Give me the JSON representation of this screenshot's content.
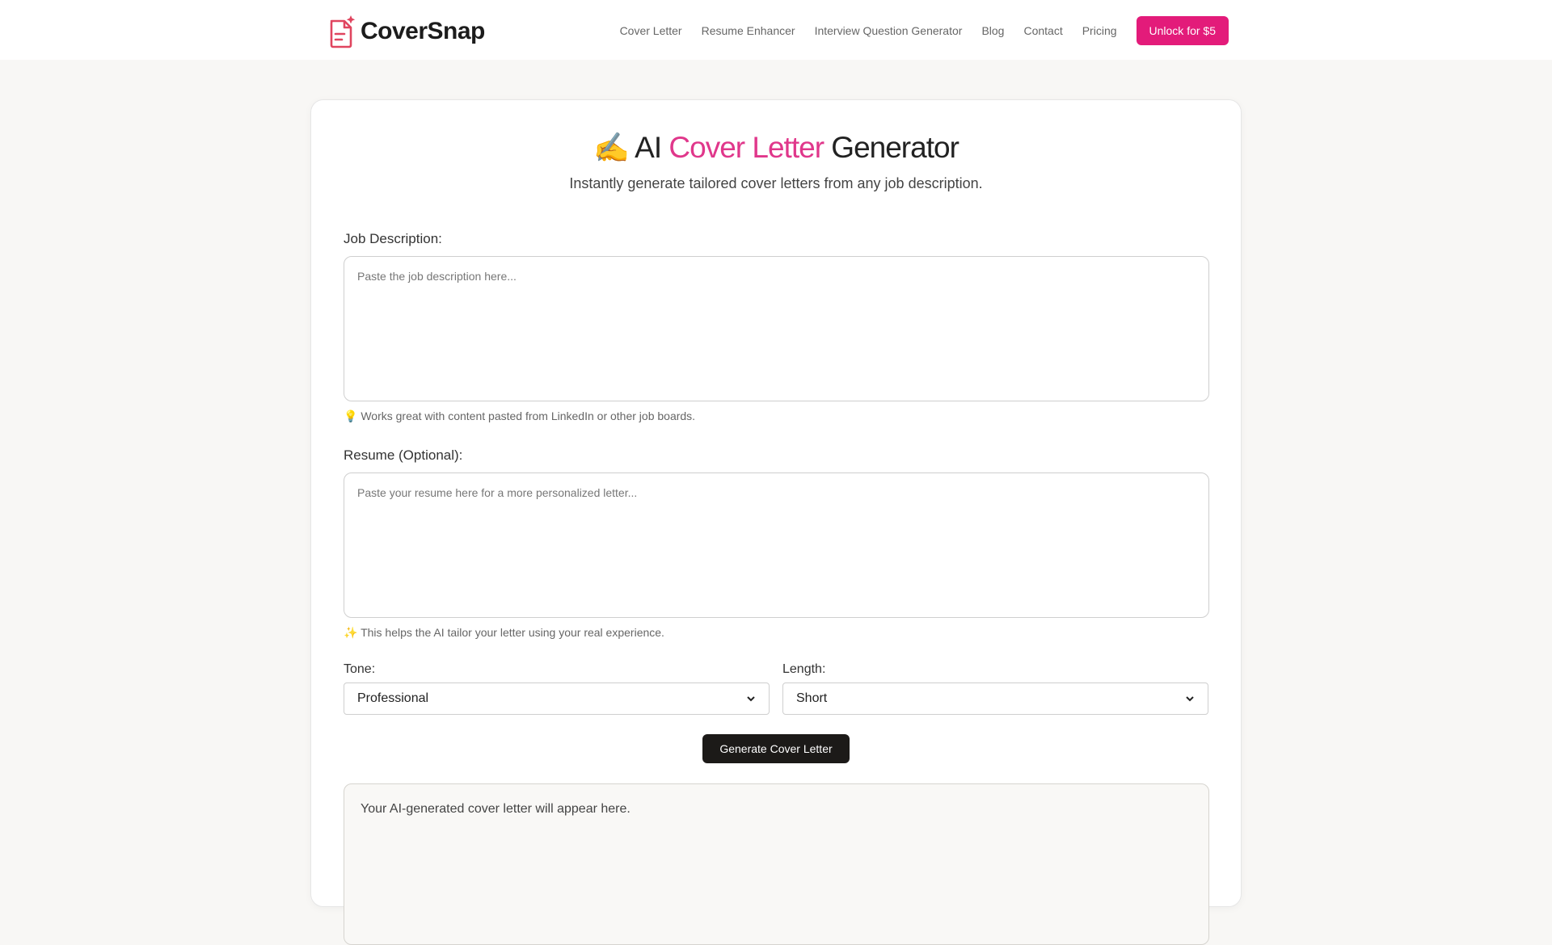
{
  "brand": {
    "name": "CoverSnap"
  },
  "nav": {
    "links": [
      "Cover Letter",
      "Resume Enhancer",
      "Interview Question Generator",
      "Blog",
      "Contact",
      "Pricing"
    ],
    "cta_label": "Unlock for $5"
  },
  "colors": {
    "accent": "#e31b7a",
    "dark_button": "#1c1a18"
  },
  "hero": {
    "emoji": "✍️",
    "title_prefix": "AI",
    "title_highlight": "Cover Letter",
    "title_suffix": "Generator",
    "subtitle": "Instantly generate tailored cover letters from any job description."
  },
  "form": {
    "job_label": "Job Description:",
    "job_placeholder": "Paste the job description here...",
    "job_hint_icon": "💡",
    "job_hint": "Works great with content pasted from LinkedIn or other job boards.",
    "resume_label": "Resume (Optional):",
    "resume_placeholder": "Paste your resume here for a more personalized letter...",
    "resume_hint_icon": "✨",
    "resume_hint": "This helps the AI tailor your letter using your real experience.",
    "tone_label": "Tone:",
    "tone_value": "Professional",
    "length_label": "Length:",
    "length_value": "Short",
    "generate_label": "Generate Cover Letter"
  },
  "output": {
    "placeholder_text": "Your AI-generated cover letter will appear here."
  }
}
